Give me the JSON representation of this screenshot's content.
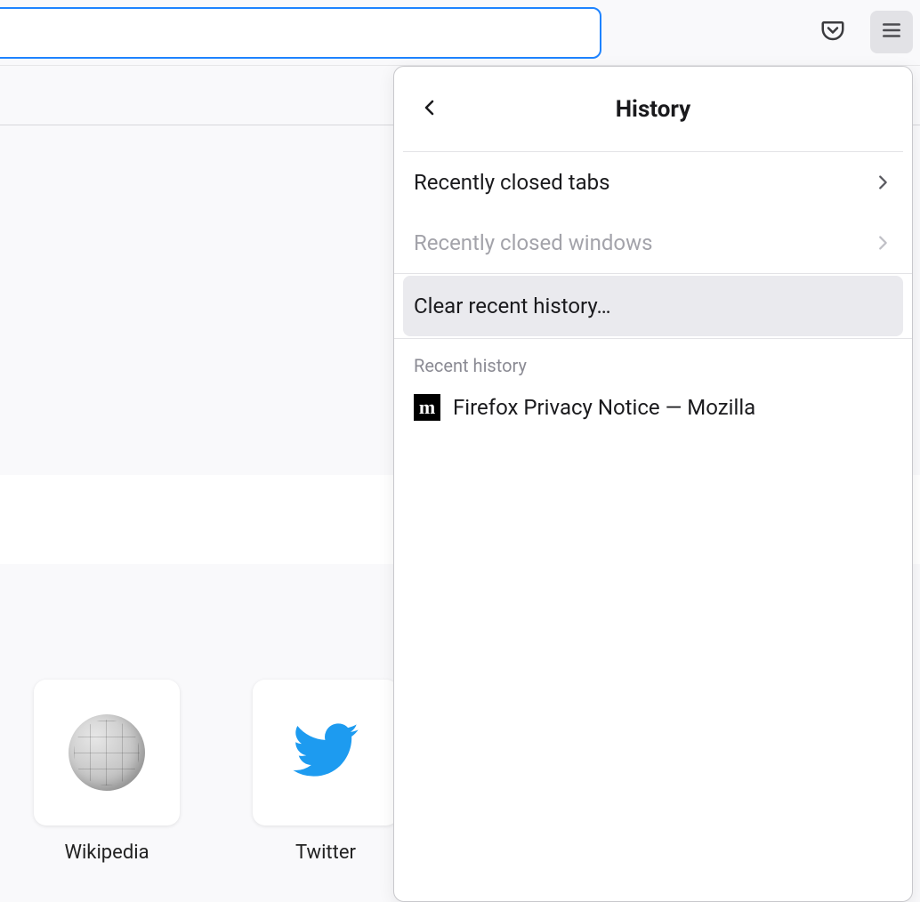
{
  "toolbar": {
    "url_value": "",
    "pocket_icon": "pocket-icon",
    "menu_icon": "hamburger-icon"
  },
  "history_panel": {
    "title": "History",
    "back_icon": "chevron-left-icon",
    "rows": [
      {
        "label": "Recently closed tabs",
        "enabled": true
      },
      {
        "label": "Recently closed windows",
        "enabled": false
      }
    ],
    "clear_label": "Clear recent history…",
    "section_label": "Recent history",
    "items": [
      {
        "title": "Firefox Privacy Notice — Mozilla",
        "favicon": "mozilla-icon",
        "favicon_letter": "m"
      }
    ]
  },
  "shortcuts": [
    {
      "label": "Wikipedia",
      "icon": "wikipedia-icon"
    },
    {
      "label": "Twitter",
      "icon": "twitter-icon"
    }
  ]
}
